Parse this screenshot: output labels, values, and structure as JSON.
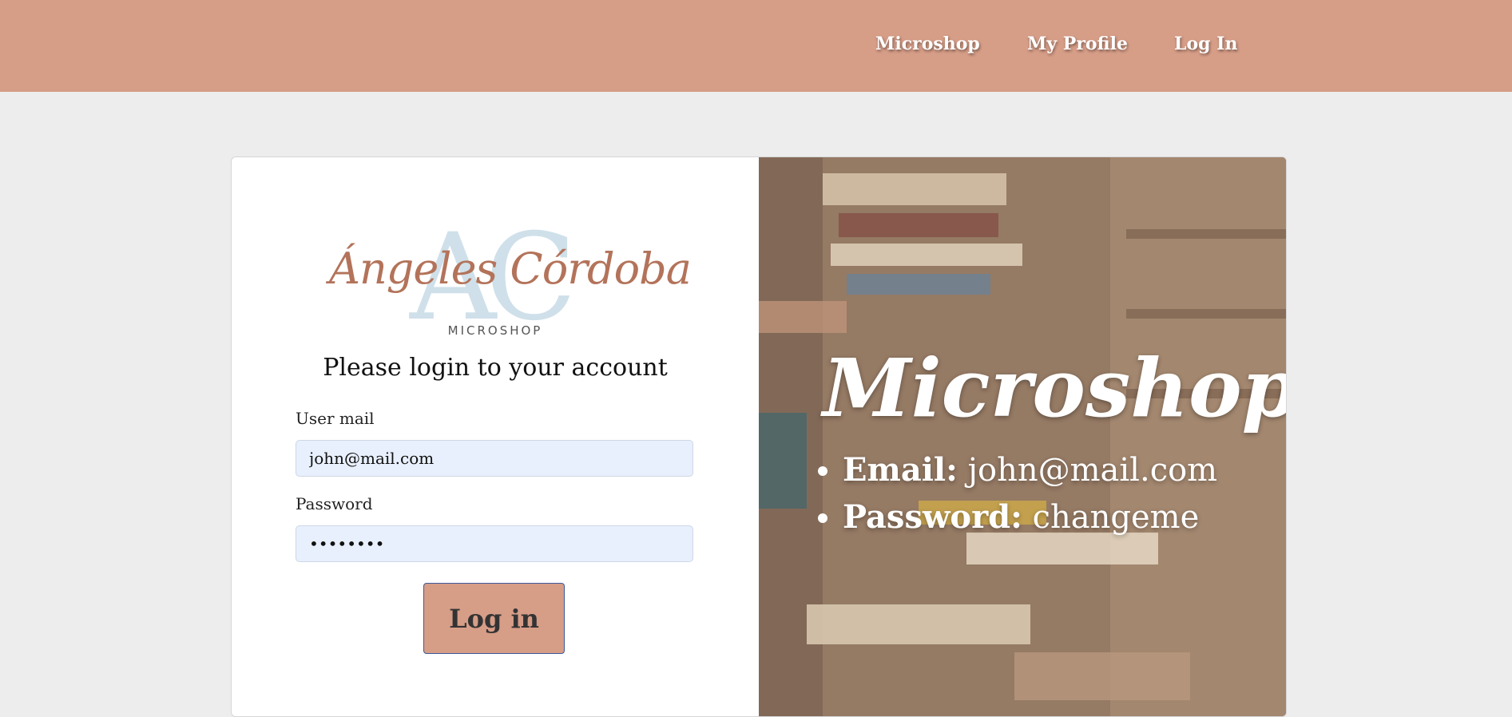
{
  "nav": {
    "links": [
      "Microshop",
      "My Profile",
      "Log In"
    ]
  },
  "logo": {
    "monogram": "AC",
    "script": "Ángeles Córdoba",
    "subtitle": "MICROSHOP"
  },
  "login": {
    "title": "Please login to your account",
    "mail_label": "User mail",
    "mail_value": "john@mail.com",
    "password_label": "Password",
    "password_value": "changeme",
    "button_label": "Log in"
  },
  "promo": {
    "title": "Microshop",
    "credentials": [
      {
        "key": "Email:",
        "value": " john@mail.com"
      },
      {
        "key": "Password:",
        "value": " changeme"
      }
    ]
  },
  "colors": {
    "accent": "#d69d87",
    "background": "#ededed",
    "input_bg": "#e8f0fd",
    "logo_script": "#b3735a",
    "logo_mono": "#cfe0ea"
  }
}
